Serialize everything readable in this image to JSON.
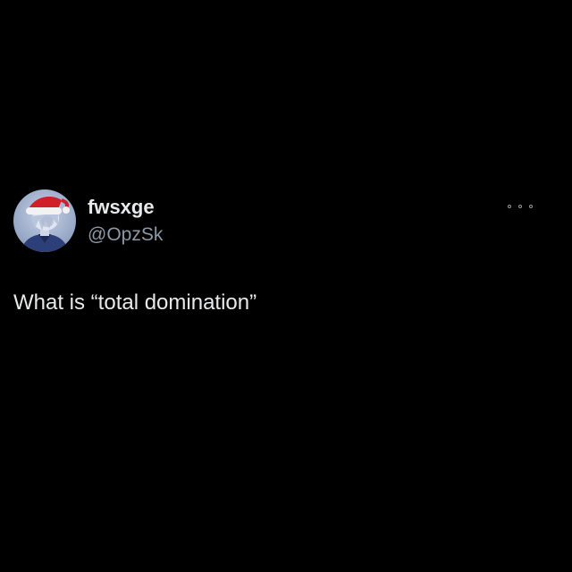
{
  "tweet": {
    "author": {
      "display_name": "fwsxge",
      "handle": "@OpzSk",
      "avatar_icon": "profile-avatar-santa-hat"
    },
    "more_icon": "more-options-icon",
    "text": "What is “total domination”"
  },
  "colors": {
    "background": "#000000",
    "primary_text": "#e7e9ea",
    "secondary_text": "#8b98a5"
  }
}
